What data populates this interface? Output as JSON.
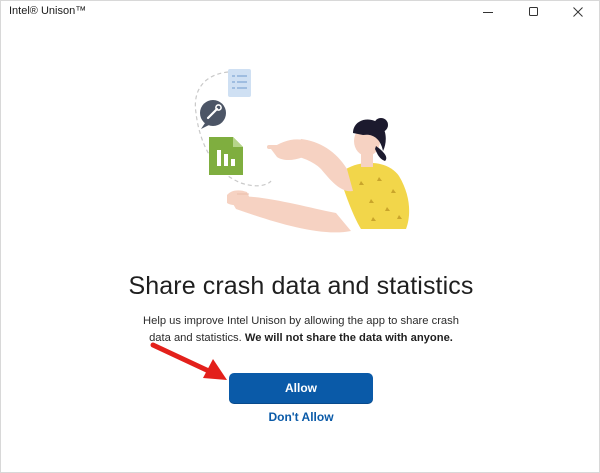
{
  "window": {
    "title": "Intel® Unison™",
    "controls": [
      "minimize-icon",
      "maximize-icon",
      "close-icon"
    ]
  },
  "dialog": {
    "heading": "Share crash data and statistics",
    "body_plain": "Help us improve Intel Unison by allowing the app to share crash data and statistics. ",
    "body_bold": "We will not share the data with anyone.",
    "allow_label": "Allow",
    "dont_allow_label": "Don't Allow"
  },
  "colors": {
    "accent": "#0a5aa8",
    "annotation_arrow": "#e3201b",
    "illustration_shirt": "#f2d64a",
    "illustration_skin": "#f6d2c2",
    "illustration_hair": "#1c1a2e",
    "illustration_doc_green": "#7fae3f",
    "illustration_wrench_bubble": "#4c5566"
  },
  "annotation": {
    "icon": "red-arrow-icon"
  }
}
